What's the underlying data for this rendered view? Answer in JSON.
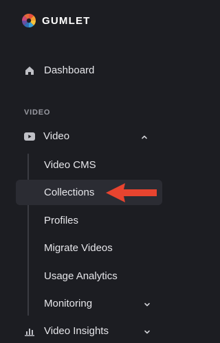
{
  "brand": {
    "name": "GUMLET"
  },
  "nav": {
    "dashboard": {
      "label": "Dashboard",
      "icon": "home-icon"
    },
    "section_title": "VIDEO",
    "video": {
      "label": "Video",
      "icon": "youtube-icon",
      "expanded": true
    },
    "video_sub_items": [
      {
        "label": "Video CMS"
      },
      {
        "label": "Collections",
        "active": true
      },
      {
        "label": "Profiles"
      },
      {
        "label": "Migrate Videos"
      },
      {
        "label": "Usage Analytics"
      },
      {
        "label": "Monitoring",
        "has_submenu": true
      }
    ],
    "video_insights": {
      "label": "Video Insights",
      "icon": "bar-chart-icon"
    }
  },
  "colors": {
    "background": "#1c1d22",
    "active_item_bg": "#2b2c33",
    "annotation_arrow": "#e8442f"
  }
}
